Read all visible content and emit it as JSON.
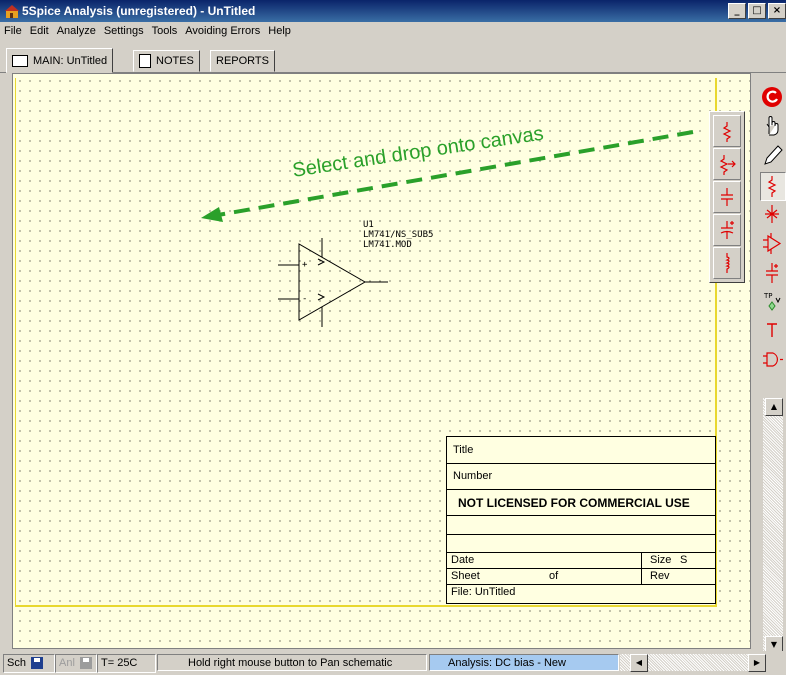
{
  "window": {
    "title": "5Spice Analysis (unregistered) - UnTitled",
    "minimize": "_",
    "maximize": "□",
    "close": "×"
  },
  "menu": [
    "File",
    "Edit",
    "Analyze",
    "Settings",
    "Tools",
    "Avoiding Errors",
    "Help"
  ],
  "tabs": [
    {
      "label": "MAIN: UnTitled",
      "icon": "schematic-icon",
      "active": true
    },
    {
      "label": "NOTES",
      "icon": "notes-icon",
      "active": false
    },
    {
      "label": "REPORTS",
      "icon": "",
      "active": false
    }
  ],
  "schematic": {
    "annotation": "Select and drop onto canvas",
    "annotation_color": "#2aa02a",
    "part": {
      "ref": "U1",
      "model": "LM741/NS_SUB5",
      "file": "LM741.MOD",
      "plus": "+",
      "minus": "-"
    }
  },
  "title_block": {
    "title_label": "Title",
    "number_label": "Number",
    "license_notice": "NOT LICENSED FOR COMMERCIAL USE",
    "date_label": "Date",
    "size_label": "Size",
    "size_value": "S",
    "sheet_label": "Sheet",
    "of_label": "of",
    "rev_label": "Rev",
    "file_label": "File: UnTitled"
  },
  "floating_palette": [
    "resistor-icon",
    "resistor-tap-icon",
    "capacitor-icon",
    "polarized-capacitor-icon",
    "inductor-icon"
  ],
  "right_toolbar": [
    "refresh-icon",
    "hand-pan-icon",
    "pencil-icon",
    "resistor-tool-icon",
    "ground-tool-icon",
    "opamp-tool-icon",
    "capacitor-tool-icon",
    "test-point-icon",
    "text-tool-icon",
    "logic-gate-icon"
  ],
  "statusbar": {
    "sch_label": "Sch",
    "anl_label": "Anl",
    "temperature": "T= 25C",
    "hint": "Hold right mouse button to Pan schematic",
    "analysis": "Analysis:  DC bias - New",
    "hint_color": "#a6caf0"
  },
  "colors": {
    "canvas_bg": "#ffffe1",
    "sheet_border": "#e8d830",
    "component_red": "#e00000"
  }
}
